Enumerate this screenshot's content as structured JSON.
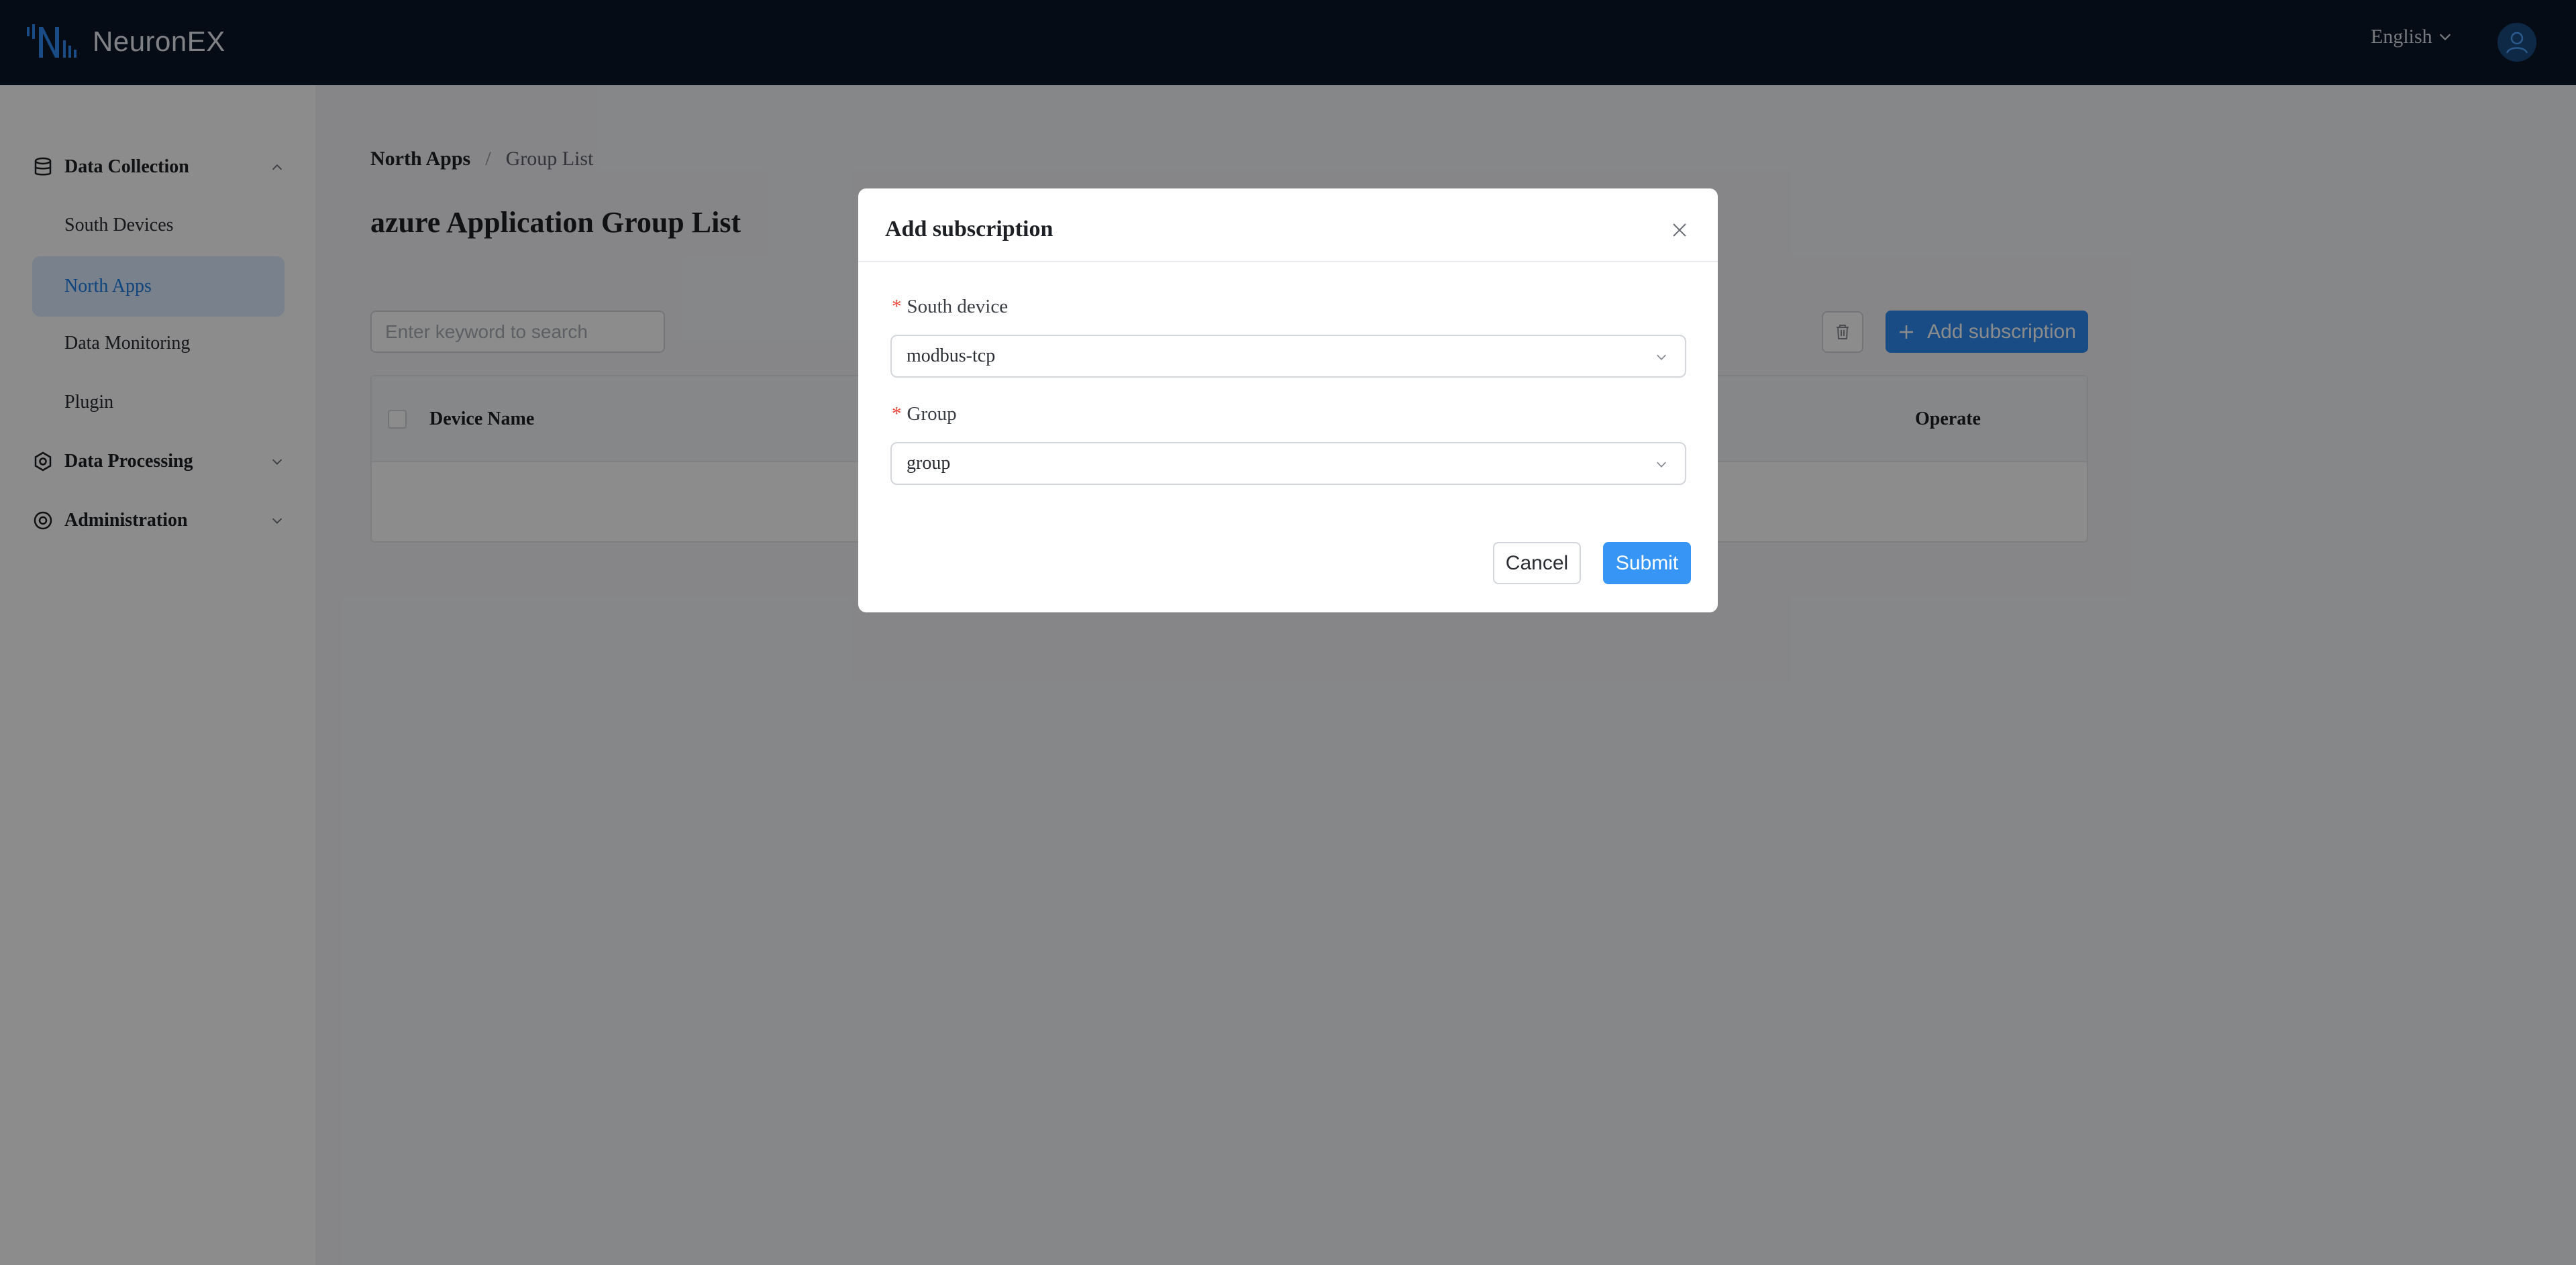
{
  "header": {
    "app_name": "NeuronEX",
    "language": "English"
  },
  "sidebar": {
    "groups": [
      {
        "label": "Data Collection",
        "icon": "database-icon",
        "expanded": true,
        "items": [
          {
            "label": "South Devices",
            "active": false
          },
          {
            "label": "North Apps",
            "active": true
          },
          {
            "label": "Data Monitoring",
            "active": false
          },
          {
            "label": "Plugin",
            "active": false
          }
        ]
      },
      {
        "label": "Data Processing",
        "icon": "processing-icon",
        "expanded": false
      },
      {
        "label": "Administration",
        "icon": "settings-icon",
        "expanded": false
      }
    ]
  },
  "main": {
    "breadcrumb": [
      "North Apps",
      "Group List"
    ],
    "breadcrumb_separator": "/",
    "title": "azure Application Group List",
    "search_placeholder": "Enter keyword to search",
    "add_button_label": "Add subscription",
    "table": {
      "columns": [
        "Device Name",
        "Operate"
      ]
    }
  },
  "modal": {
    "title": "Add subscription",
    "fields": [
      {
        "label": "South device",
        "required": true,
        "value": "modbus-tcp"
      },
      {
        "label": "Group",
        "required": true,
        "value": "group"
      }
    ],
    "cancel_label": "Cancel",
    "submit_label": "Submit"
  },
  "colors": {
    "header_bg": "#0a1628",
    "accent": "#2e8bf0",
    "active_bg": "#dcecff",
    "required": "#f04438"
  }
}
